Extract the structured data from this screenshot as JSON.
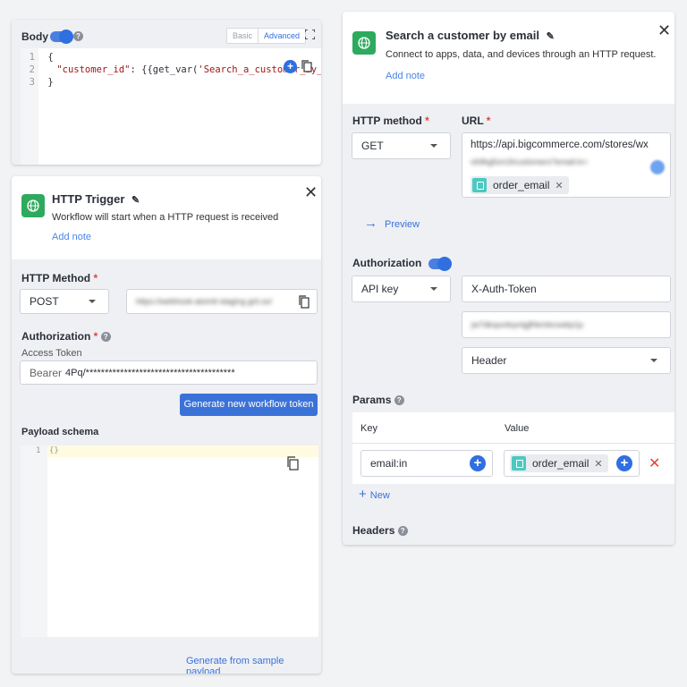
{
  "body_card": {
    "title": "Body",
    "tab_basic": "Basic",
    "tab_advanced": "Advanced",
    "code_lines": [
      {
        "num": "1",
        "text": "{"
      },
      {
        "num": "2",
        "key": "\"customer_id\"",
        "rest": ": {{get_var(",
        "str": "'Search_a_customer_by_ema"
      },
      {
        "num": "3",
        "text": "}"
      }
    ]
  },
  "http_trigger": {
    "title": "HTTP Trigger",
    "subtitle": "Workflow will start when a HTTP request is received",
    "add_note": "Add note",
    "method_label": "HTTP Method",
    "method_required": "*",
    "method_value": "POST",
    "webhook_url": "https://webhook-atomtl-staging.grit.so/",
    "auth_label": "Authorization",
    "auth_required": "*",
    "access_token_label": "Access Token",
    "token_prefix": "Bearer",
    "token_value": "4Pq/***************************************",
    "generate_token_button": "Generate new workflow token",
    "payload_label": "Payload schema",
    "payload_line_num": "1",
    "payload_text": "{}",
    "generate_sample_link": "Generate from sample payload"
  },
  "search_card": {
    "title": "Search a customer by email",
    "subtitle": "Connect to apps, data, and devices through an HTTP request.",
    "add_note": "Add note",
    "http_method_label": "HTTP method",
    "url_label": "URL",
    "required_mark": "*",
    "method_value": "GET",
    "url_line1": "https://api.bigcommerce.com/stores/wx",
    "url_line2_blurred": "vb9bg5s/v3/customers?email:in=",
    "url_chip": "order_email",
    "preview": "Preview",
    "authorization_label": "Authorization",
    "auth_type": "API key",
    "auth_header_name": "X-Auth-Token",
    "auth_key_blurred": "jw7dkspvdsynlgjfhkmbcswbp1p",
    "auth_location": "Header",
    "params_label": "Params",
    "params_key_header": "Key",
    "params_value_header": "Value",
    "param_key": "email:in",
    "param_value_chip": "order_email",
    "new_link": "New",
    "headers_label": "Headers"
  },
  "colors": {
    "accent": "#2f6fe0",
    "green_icon": "#2eaa5e",
    "chip_icon": "#4cc9c0",
    "required": "#e0443a"
  }
}
